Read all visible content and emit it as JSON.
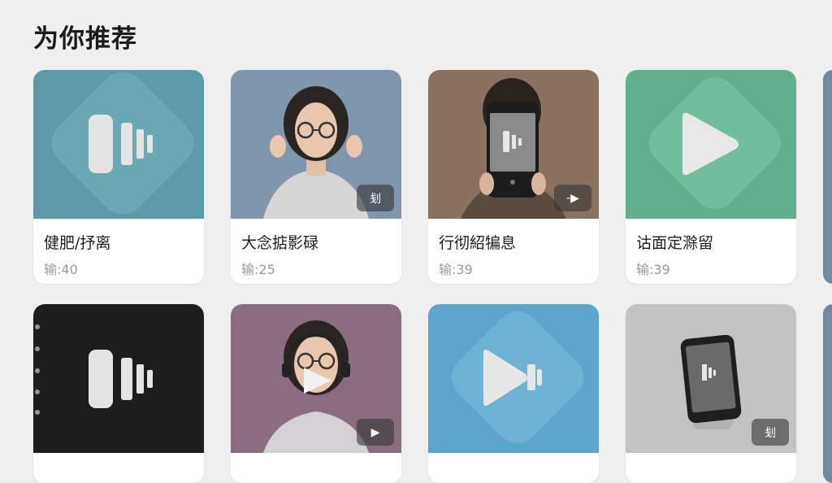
{
  "section": {
    "title": "为你推荐"
  },
  "cards": [
    {
      "title": "健肥/抒离",
      "meta": "输:40",
      "tag": ""
    },
    {
      "title": "大念掂影碌",
      "meta": "输:25",
      "tag": "刬"
    },
    {
      "title": "行彻紹犏息",
      "meta": "输:39",
      "tag": "-▶"
    },
    {
      "title": "诂面定滁留",
      "meta": "输:39",
      "tag": ""
    },
    {
      "title": "",
      "meta": "",
      "tag": ""
    },
    {
      "title": "",
      "meta": "",
      "tag": "▶"
    },
    {
      "title": "",
      "meta": "",
      "tag": ""
    },
    {
      "title": "",
      "meta": "",
      "tag": "刬"
    }
  ],
  "colors": {
    "teal": "#5b9aa6",
    "portrait_bg": "#7f96ad",
    "brown": "#8a7260",
    "green": "#64b08e",
    "dark": "#1d1d1d",
    "purple": "#8a6d80",
    "blue": "#5ea5cc",
    "gray": "#c3c3c3"
  },
  "icons": [
    "audio-bars-icon",
    "play-icon",
    "phone-icon",
    "person-photo"
  ]
}
